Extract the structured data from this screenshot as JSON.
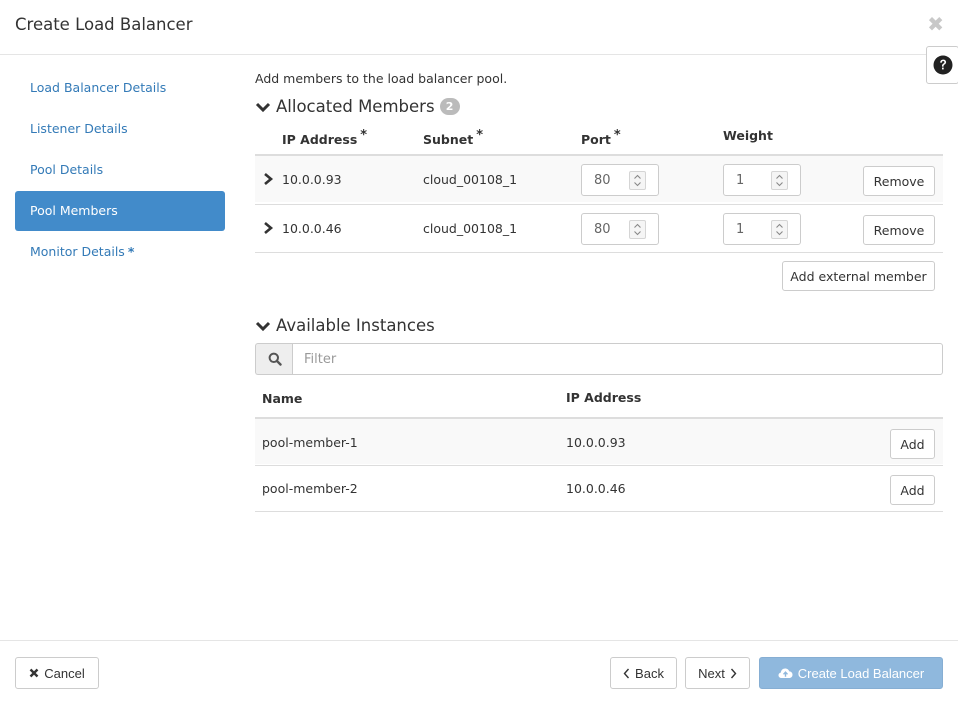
{
  "modal": {
    "title": "Create Load Balancer",
    "close_glyph": "✖",
    "help_icon": "question-circle-icon"
  },
  "sidebar": {
    "items": [
      {
        "label": "Load Balancer Details",
        "active": false,
        "required": false
      },
      {
        "label": "Listener Details",
        "active": false,
        "required": false
      },
      {
        "label": "Pool Details",
        "active": false,
        "required": false
      },
      {
        "label": "Pool Members",
        "active": true,
        "required": false
      },
      {
        "label": "Monitor Details",
        "active": false,
        "required": true
      }
    ],
    "required_marker": "*"
  },
  "main": {
    "intro": "Add members to the load balancer pool.",
    "allocated": {
      "title": "Allocated Members",
      "count": "2",
      "columns": {
        "ip": "IP Address",
        "subnet": "Subnet",
        "port": "Port",
        "weight": "Weight",
        "star": "*"
      },
      "rows": [
        {
          "ip": "10.0.0.93",
          "subnet": "cloud_00108_1",
          "port": "80",
          "weight": "1",
          "action": "Remove"
        },
        {
          "ip": "10.0.0.46",
          "subnet": "cloud_00108_1",
          "port": "80",
          "weight": "1",
          "action": "Remove"
        }
      ],
      "add_external": "Add external member"
    },
    "available": {
      "title": "Available Instances",
      "filter_placeholder": "Filter",
      "columns": {
        "name": "Name",
        "ip": "IP Address"
      },
      "rows": [
        {
          "name": "pool-member-1",
          "ip": "10.0.0.93",
          "action": "Add"
        },
        {
          "name": "pool-member-2",
          "ip": "10.0.0.46",
          "action": "Add"
        }
      ]
    }
  },
  "footer": {
    "cancel": "Cancel",
    "back": "Back",
    "next": "Next",
    "create": "Create Load Balancer"
  },
  "colors": {
    "link": "#337ab7",
    "active_nav": "#428bca",
    "primary_disabled": "#8fb8dd"
  }
}
